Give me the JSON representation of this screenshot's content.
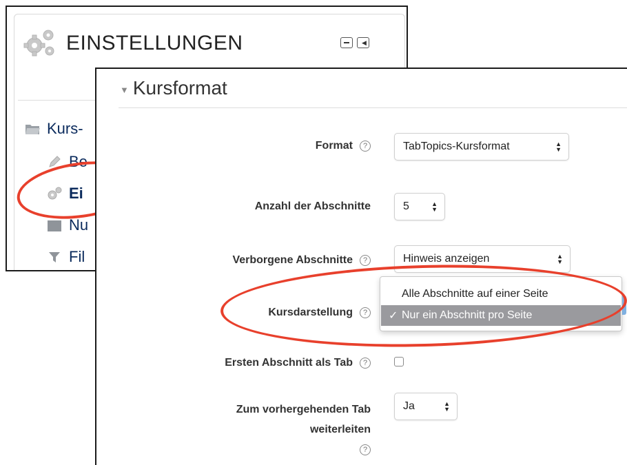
{
  "settings_block": {
    "title": "EINSTELLUNGEN",
    "icon": "gears-icon",
    "controls": [
      "hide-block-icon",
      "dock-block-icon"
    ],
    "nav_items": [
      {
        "label": "Kurs-",
        "icon": "folder-icon"
      },
      {
        "label": "Be",
        "icon": "pencil-icon"
      },
      {
        "label": "Ei",
        "icon": "gears-icon"
      },
      {
        "label": "Nu",
        "icon": "users-icon"
      },
      {
        "label": "Fil",
        "icon": "filter-icon"
      }
    ]
  },
  "form": {
    "section_title": "Kursformat",
    "fields": {
      "format": {
        "label": "Format",
        "value": "TabTopics-Kursformat"
      },
      "sections": {
        "label": "Anzahl der Abschnitte",
        "value": "5"
      },
      "hidden": {
        "label": "Verborgene Abschnitte",
        "value": "Hinweis anzeigen"
      },
      "layout": {
        "label": "Kursdarstellung",
        "options": [
          "Alle Abschnitte auf einer Seite",
          "Nur ein Abschnitt pro Seite"
        ],
        "selected": "Nur ein Abschnitt pro Seite",
        "check": "✓"
      },
      "first_tab": {
        "label": "Ersten Abschnitt als Tab",
        "checked": false
      },
      "redirect": {
        "label_line1": "Zum vorhergehenden Tab",
        "label_line2": "weiterleiten",
        "value": "Ja"
      }
    },
    "help_glyph": "?"
  },
  "colors": {
    "highlight": "#e8402c",
    "link": "#0a2a5c",
    "selected_bg": "#9a9a9e"
  }
}
